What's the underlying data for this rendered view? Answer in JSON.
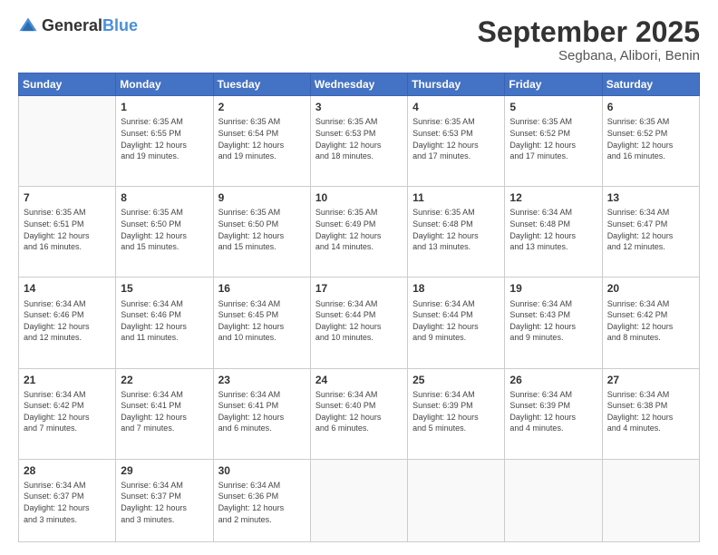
{
  "header": {
    "logo_general": "General",
    "logo_blue": "Blue",
    "month": "September 2025",
    "location": "Segbana, Alibori, Benin"
  },
  "weekdays": [
    "Sunday",
    "Monday",
    "Tuesday",
    "Wednesday",
    "Thursday",
    "Friday",
    "Saturday"
  ],
  "weeks": [
    [
      {
        "day": "",
        "info": ""
      },
      {
        "day": "1",
        "info": "Sunrise: 6:35 AM\nSunset: 6:55 PM\nDaylight: 12 hours\nand 19 minutes."
      },
      {
        "day": "2",
        "info": "Sunrise: 6:35 AM\nSunset: 6:54 PM\nDaylight: 12 hours\nand 19 minutes."
      },
      {
        "day": "3",
        "info": "Sunrise: 6:35 AM\nSunset: 6:53 PM\nDaylight: 12 hours\nand 18 minutes."
      },
      {
        "day": "4",
        "info": "Sunrise: 6:35 AM\nSunset: 6:53 PM\nDaylight: 12 hours\nand 17 minutes."
      },
      {
        "day": "5",
        "info": "Sunrise: 6:35 AM\nSunset: 6:52 PM\nDaylight: 12 hours\nand 17 minutes."
      },
      {
        "day": "6",
        "info": "Sunrise: 6:35 AM\nSunset: 6:52 PM\nDaylight: 12 hours\nand 16 minutes."
      }
    ],
    [
      {
        "day": "7",
        "info": "Sunrise: 6:35 AM\nSunset: 6:51 PM\nDaylight: 12 hours\nand 16 minutes."
      },
      {
        "day": "8",
        "info": "Sunrise: 6:35 AM\nSunset: 6:50 PM\nDaylight: 12 hours\nand 15 minutes."
      },
      {
        "day": "9",
        "info": "Sunrise: 6:35 AM\nSunset: 6:50 PM\nDaylight: 12 hours\nand 15 minutes."
      },
      {
        "day": "10",
        "info": "Sunrise: 6:35 AM\nSunset: 6:49 PM\nDaylight: 12 hours\nand 14 minutes."
      },
      {
        "day": "11",
        "info": "Sunrise: 6:35 AM\nSunset: 6:48 PM\nDaylight: 12 hours\nand 13 minutes."
      },
      {
        "day": "12",
        "info": "Sunrise: 6:34 AM\nSunset: 6:48 PM\nDaylight: 12 hours\nand 13 minutes."
      },
      {
        "day": "13",
        "info": "Sunrise: 6:34 AM\nSunset: 6:47 PM\nDaylight: 12 hours\nand 12 minutes."
      }
    ],
    [
      {
        "day": "14",
        "info": "Sunrise: 6:34 AM\nSunset: 6:46 PM\nDaylight: 12 hours\nand 12 minutes."
      },
      {
        "day": "15",
        "info": "Sunrise: 6:34 AM\nSunset: 6:46 PM\nDaylight: 12 hours\nand 11 minutes."
      },
      {
        "day": "16",
        "info": "Sunrise: 6:34 AM\nSunset: 6:45 PM\nDaylight: 12 hours\nand 10 minutes."
      },
      {
        "day": "17",
        "info": "Sunrise: 6:34 AM\nSunset: 6:44 PM\nDaylight: 12 hours\nand 10 minutes."
      },
      {
        "day": "18",
        "info": "Sunrise: 6:34 AM\nSunset: 6:44 PM\nDaylight: 12 hours\nand 9 minutes."
      },
      {
        "day": "19",
        "info": "Sunrise: 6:34 AM\nSunset: 6:43 PM\nDaylight: 12 hours\nand 9 minutes."
      },
      {
        "day": "20",
        "info": "Sunrise: 6:34 AM\nSunset: 6:42 PM\nDaylight: 12 hours\nand 8 minutes."
      }
    ],
    [
      {
        "day": "21",
        "info": "Sunrise: 6:34 AM\nSunset: 6:42 PM\nDaylight: 12 hours\nand 7 minutes."
      },
      {
        "day": "22",
        "info": "Sunrise: 6:34 AM\nSunset: 6:41 PM\nDaylight: 12 hours\nand 7 minutes."
      },
      {
        "day": "23",
        "info": "Sunrise: 6:34 AM\nSunset: 6:41 PM\nDaylight: 12 hours\nand 6 minutes."
      },
      {
        "day": "24",
        "info": "Sunrise: 6:34 AM\nSunset: 6:40 PM\nDaylight: 12 hours\nand 6 minutes."
      },
      {
        "day": "25",
        "info": "Sunrise: 6:34 AM\nSunset: 6:39 PM\nDaylight: 12 hours\nand 5 minutes."
      },
      {
        "day": "26",
        "info": "Sunrise: 6:34 AM\nSunset: 6:39 PM\nDaylight: 12 hours\nand 4 minutes."
      },
      {
        "day": "27",
        "info": "Sunrise: 6:34 AM\nSunset: 6:38 PM\nDaylight: 12 hours\nand 4 minutes."
      }
    ],
    [
      {
        "day": "28",
        "info": "Sunrise: 6:34 AM\nSunset: 6:37 PM\nDaylight: 12 hours\nand 3 minutes."
      },
      {
        "day": "29",
        "info": "Sunrise: 6:34 AM\nSunset: 6:37 PM\nDaylight: 12 hours\nand 3 minutes."
      },
      {
        "day": "30",
        "info": "Sunrise: 6:34 AM\nSunset: 6:36 PM\nDaylight: 12 hours\nand 2 minutes."
      },
      {
        "day": "",
        "info": ""
      },
      {
        "day": "",
        "info": ""
      },
      {
        "day": "",
        "info": ""
      },
      {
        "day": "",
        "info": ""
      }
    ]
  ]
}
